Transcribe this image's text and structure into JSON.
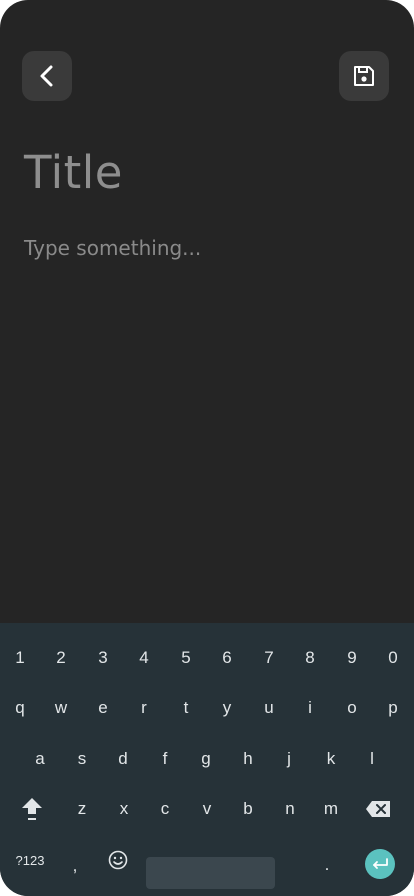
{
  "editor": {
    "title_placeholder": "Title",
    "body_placeholder": "Type something..."
  },
  "buttons": {
    "back_icon": "chevron-left-icon",
    "save_icon": "floppy-disk-icon"
  },
  "keyboard": {
    "row1": [
      "1",
      "2",
      "3",
      "4",
      "5",
      "6",
      "7",
      "8",
      "9",
      "0"
    ],
    "row2": [
      "q",
      "w",
      "e",
      "r",
      "t",
      "y",
      "u",
      "i",
      "o",
      "p"
    ],
    "row3": [
      "a",
      "s",
      "d",
      "f",
      "g",
      "h",
      "j",
      "k",
      "l"
    ],
    "row4": [
      "z",
      "x",
      "c",
      "v",
      "b",
      "n",
      "m"
    ],
    "symbols_label": "?123",
    "comma_label": ",",
    "period_label": ".",
    "accent_color": "#5bc2bf"
  }
}
